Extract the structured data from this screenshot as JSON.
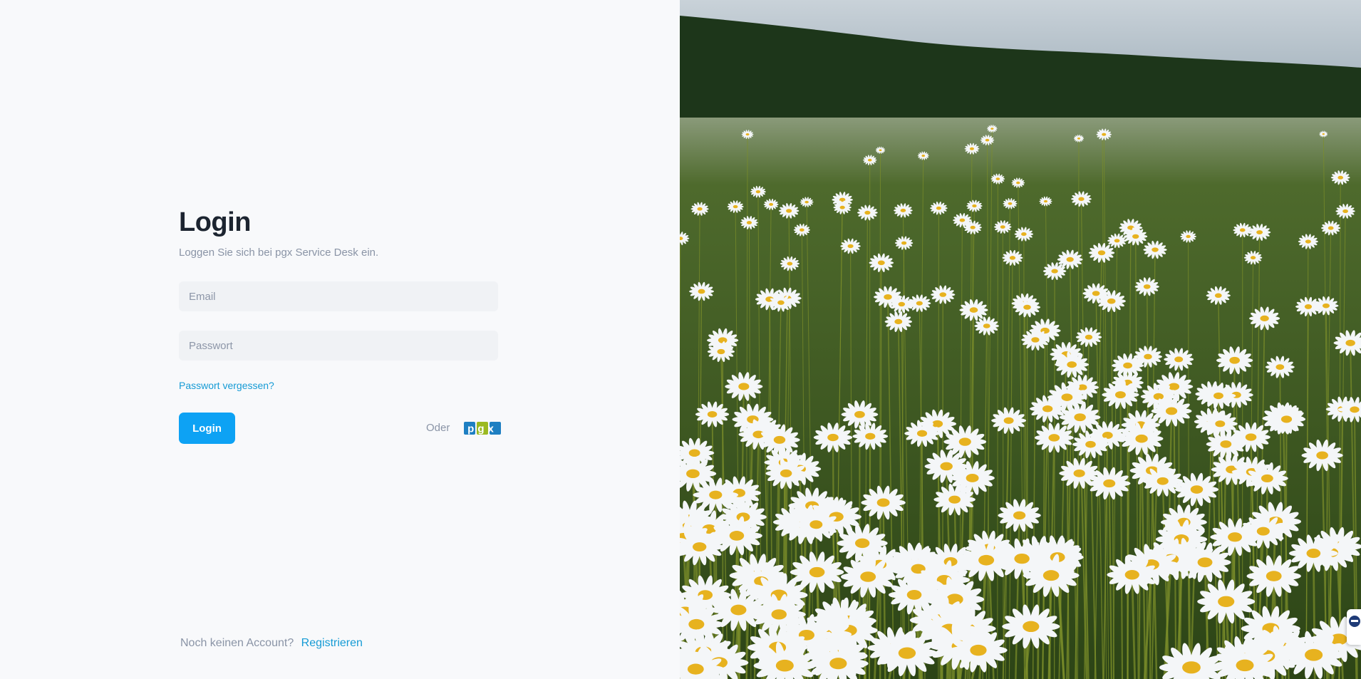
{
  "login": {
    "title": "Login",
    "subtitle": "Loggen Sie sich bei pgx Service Desk ein.",
    "email_placeholder": "Email",
    "password_placeholder": "Passwort",
    "forgot_label": "Passwort vergessen?",
    "button_label": "Login",
    "or_label": "Oder",
    "sso_logo_text": "pgx",
    "sso_logo_colors": [
      "#1e7fc2",
      "#9bb920",
      "#1e7fc2"
    ]
  },
  "footer": {
    "no_account_label": "Noch keinen Account?",
    "register_label": "Registrieren"
  },
  "hero": {
    "sky_color": "#b9c6cf",
    "forest_color": "#1f3a1c",
    "field_color": "#3d5a22",
    "petal_color": "#f4f6f8",
    "center_color": "#e7b21f"
  },
  "support_widget": {
    "icon": "chat-support-icon"
  }
}
